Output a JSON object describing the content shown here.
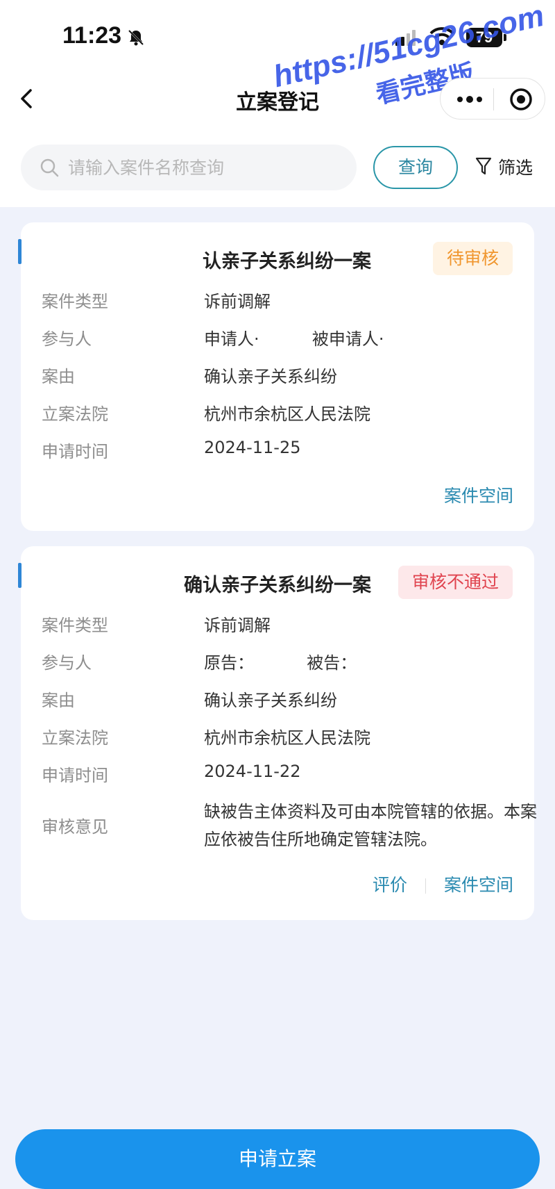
{
  "status_bar": {
    "time": "11:23",
    "battery": "79"
  },
  "watermark": {
    "line1": "https://51cg26.com",
    "line2": "看完整版"
  },
  "nav": {
    "title": "立案登记",
    "icons": [
      "back-icon",
      "more-icon",
      "target-icon"
    ]
  },
  "search": {
    "placeholder": "请输入案件名称查询",
    "query_label": "查询",
    "filter_label": "筛选"
  },
  "labels": {
    "case_type": "案件类型",
    "participants": "参与人",
    "cause": "案由",
    "court": "立案法院",
    "apply_time": "申请时间",
    "review_opinion": "审核意见"
  },
  "cases": [
    {
      "title": "认亲子关系纠纷一案",
      "status": "待审核",
      "case_type": "诉前调解",
      "participants": "申请人·          被申请人·",
      "cause": "确认亲子关系纠纷",
      "court": "杭州市余杭区人民法院",
      "apply_time": "2024-11-25",
      "links": [
        "案件空间"
      ]
    },
    {
      "title": "确认亲子关系纠纷一案",
      "status": "审核不通过",
      "case_type": "诉前调解",
      "participants": "原告：          被告：",
      "cause": "确认亲子关系纠纷",
      "court": "杭州市余杭区人民法院",
      "apply_time": "2024-11-22",
      "review_opinion": "缺被告主体资料及可由本院管辖的依据。本案应依被告住所地确定管辖法院。",
      "links": [
        "评价",
        "案件空间"
      ]
    }
  ],
  "apply_button": "申请立案",
  "colors": {
    "page_bg": "#eff2fb",
    "accent": "#1a93ec",
    "link": "#2a8ab0",
    "pending": "#f0962e",
    "reject": "#e0444f"
  }
}
